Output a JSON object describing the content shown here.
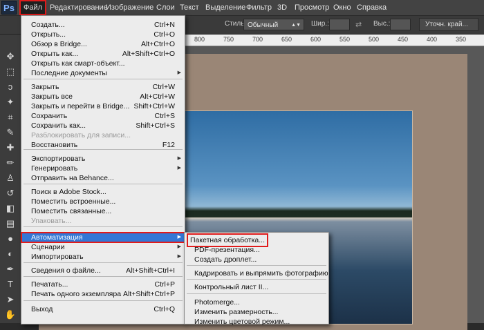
{
  "menubar": {
    "items": [
      "Файл",
      "Редактирование",
      "Изображение",
      "Слои",
      "Текст",
      "Выделение",
      "Фильтр",
      "3D",
      "Просмотр",
      "Окно",
      "Справка"
    ]
  },
  "optbar": {
    "style_label": "Стиль:",
    "style_value": "Обычный",
    "width_label": "Шир.:",
    "height_label": "Выс.:",
    "refine_button": "Уточн. край..."
  },
  "ruler": {
    "labels": [
      "800",
      "750",
      "700",
      "650",
      "600",
      "550",
      "500",
      "450",
      "400",
      "350"
    ]
  },
  "file_menu": {
    "items": [
      {
        "label": "Создать...",
        "shortcut": "Ctrl+N"
      },
      {
        "label": "Открыть...",
        "shortcut": "Ctrl+O"
      },
      {
        "label": "Обзор в Bridge...",
        "shortcut": "Alt+Ctrl+O"
      },
      {
        "label": "Открыть как...",
        "shortcut": "Alt+Shift+Ctrl+O"
      },
      {
        "label": "Открыть как смарт-объект...",
        "shortcut": ""
      },
      {
        "label": "Последние документы",
        "shortcut": "",
        "submenu": true
      },
      {
        "label": "Закрыть",
        "shortcut": "Ctrl+W"
      },
      {
        "label": "Закрыть все",
        "shortcut": "Alt+Ctrl+W"
      },
      {
        "label": "Закрыть и перейти в Bridge...",
        "shortcut": "Shift+Ctrl+W"
      },
      {
        "label": "Сохранить",
        "shortcut": "Ctrl+S"
      },
      {
        "label": "Сохранить как...",
        "shortcut": "Shift+Ctrl+S"
      },
      {
        "label": "Разблокировать для записи...",
        "shortcut": "",
        "disabled": true
      },
      {
        "label": "Восстановить",
        "shortcut": "F12"
      },
      {
        "label": "Экспортировать",
        "shortcut": "",
        "submenu": true
      },
      {
        "label": "Генерировать",
        "shortcut": "",
        "submenu": true
      },
      {
        "label": "Отправить на Behance...",
        "shortcut": ""
      },
      {
        "label": "Поиск в Adobe Stock...",
        "shortcut": ""
      },
      {
        "label": "Поместить встроенные...",
        "shortcut": ""
      },
      {
        "label": "Поместить связанные...",
        "shortcut": ""
      },
      {
        "label": "Упаковать...",
        "shortcut": "",
        "disabled": true
      },
      {
        "label": "Автоматизация",
        "shortcut": "",
        "submenu": true,
        "highlight": true
      },
      {
        "label": "Сценарии",
        "shortcut": "",
        "submenu": true
      },
      {
        "label": "Импортировать",
        "shortcut": "",
        "submenu": true
      },
      {
        "label": "Сведения о файле...",
        "shortcut": "Alt+Shift+Ctrl+I"
      },
      {
        "label": "Печатать...",
        "shortcut": "Ctrl+P"
      },
      {
        "label": "Печать одного экземпляра",
        "shortcut": "Alt+Shift+Ctrl+P"
      },
      {
        "label": "Выход",
        "shortcut": "Ctrl+Q"
      }
    ]
  },
  "automation_menu": {
    "items": [
      {
        "label": "Пакетная обработка...",
        "boxed": true
      },
      {
        "label": "PDF-презентация..."
      },
      {
        "label": "Создать дроплет..."
      },
      {
        "label": "Кадрировать и выпрямить фотографию"
      },
      {
        "label": "Контрольный лист II..."
      },
      {
        "label": "Photomerge..."
      },
      {
        "label": "Изменить размерность..."
      },
      {
        "label": "Изменить цветовой режим..."
      }
    ]
  },
  "colors": {
    "highlight": "#3377d6",
    "callout": "#e01b1b"
  }
}
